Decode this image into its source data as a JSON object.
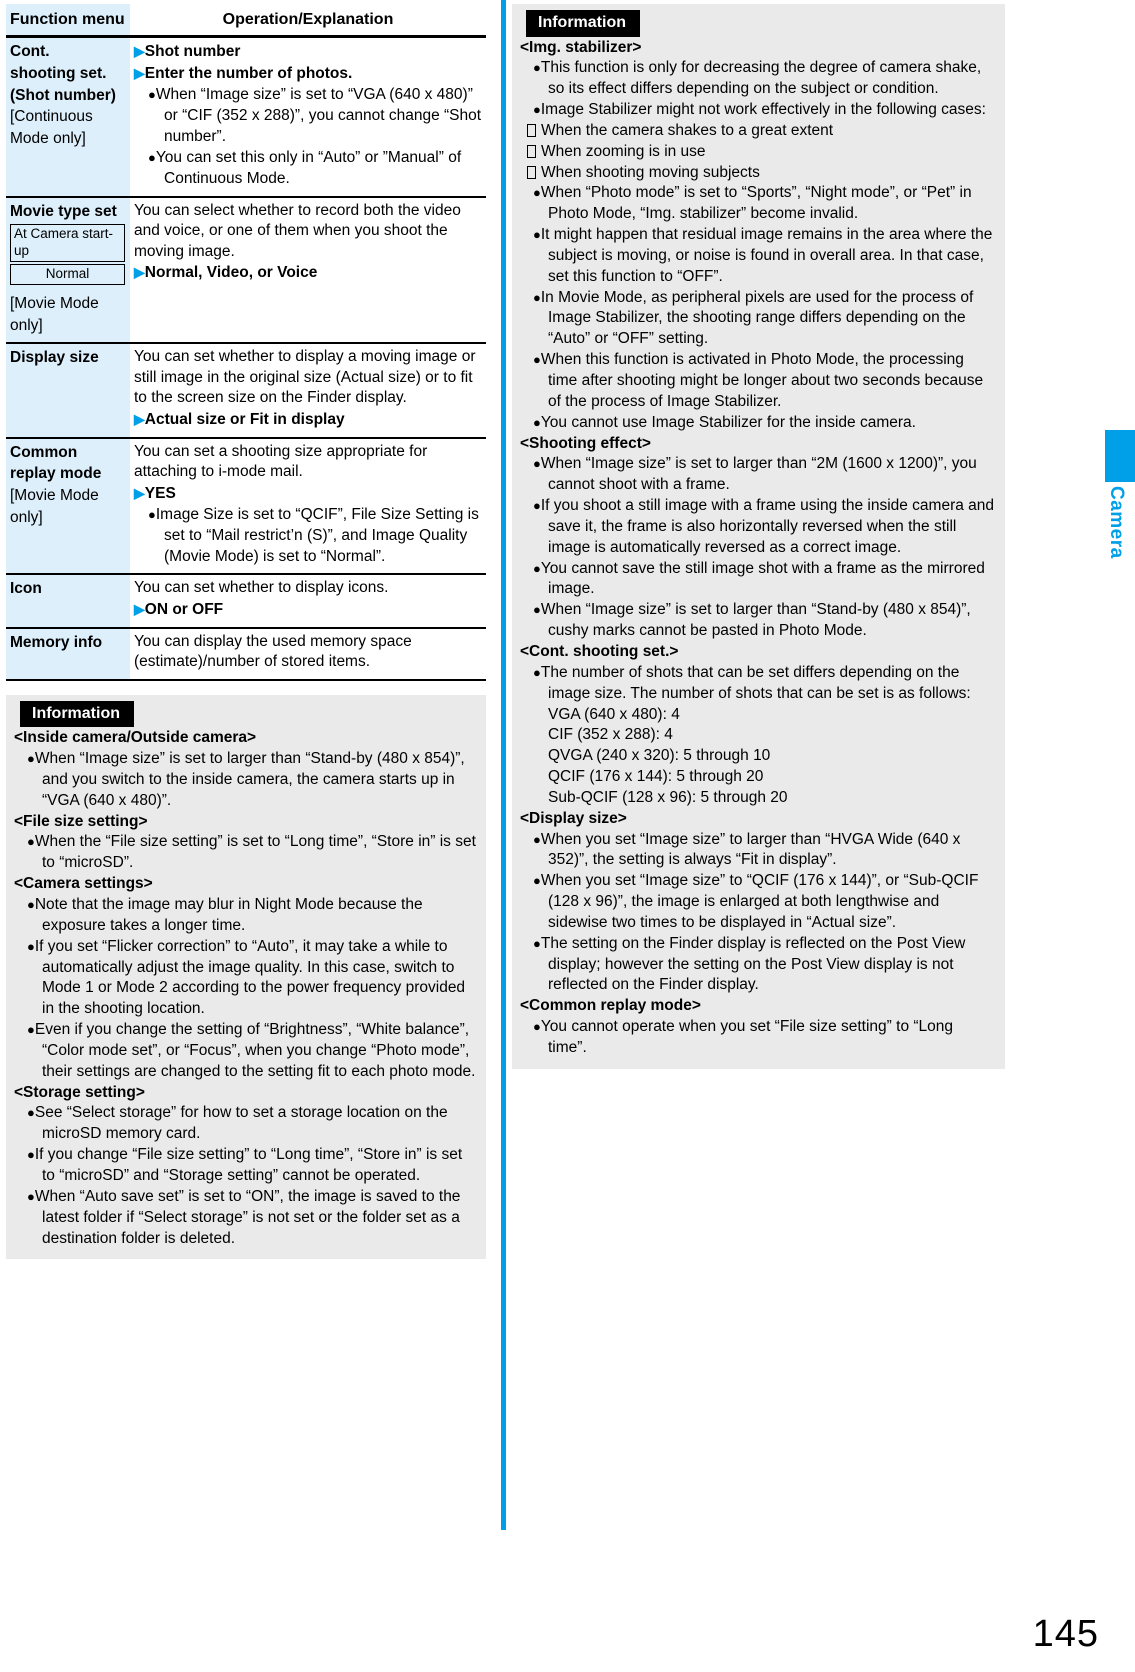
{
  "page_number": "145",
  "side_tab": {
    "label": "Camera"
  },
  "table": {
    "headers": {
      "col1": "Function menu",
      "col2": "Operation/Explanation"
    },
    "rows": [
      {
        "menu_title": "Cont.\nshooting set.\n(Shot number)",
        "menu_note": "[Continuous\nMode only]",
        "operations": [
          "Shot number",
          "Enter the number of photos."
        ],
        "bullets": [
          "When “Image size” is set to “VGA (640 x 480)” or “CIF (352 x 288)”, you cannot change “Shot number”.",
          "You can set this only in “Auto” or ”Manual” of Continuous Mode."
        ]
      },
      {
        "menu_title": "Movie type set",
        "minibox_1": "At Camera start-up",
        "minibox_2": "Normal",
        "menu_note": "[Movie Mode\nonly]",
        "desc": "You can select whether to record both the video and voice, or one of them when you shoot the moving image.",
        "operations": [
          "Normal, Video, or Voice"
        ],
        "bullets": []
      },
      {
        "menu_title": "Display size",
        "menu_note": "",
        "desc": "You can set whether to display a moving image or still image in the original size (Actual size) or to fit to the screen size on the Finder display.",
        "operations": [
          "Actual size or Fit in display"
        ],
        "bullets": []
      },
      {
        "menu_title": "Common\nreplay mode",
        "menu_note": "[Movie Mode\nonly]",
        "desc": "You can set a shooting size appropriate for attaching to i-mode mail.",
        "operations": [
          "YES"
        ],
        "bullets": [
          "Image Size is set to “QCIF”, File Size Setting is set to “Mail restrict’n (S)”, and Image Quality (Movie Mode) is set to “Normal”."
        ]
      },
      {
        "menu_title": "Icon",
        "menu_note": "",
        "desc": "You can set whether to display icons.",
        "operations": [
          "ON or OFF"
        ],
        "bullets": []
      },
      {
        "menu_title": "Memory info",
        "menu_note": "",
        "desc": "You can display the used memory space (estimate)/number of stored items.",
        "operations": [],
        "bullets": []
      }
    ]
  },
  "left_info": {
    "title": "Information",
    "blocks": [
      {
        "heading": "<Inside camera/Outside camera>",
        "items": [
          {
            "type": "bullet",
            "text": "When “Image size” is set to larger than “Stand-by (480 x 854)”, and you switch to the inside camera, the camera starts up in “VGA (640 x 480)”."
          }
        ]
      },
      {
        "heading": "<File size setting>",
        "items": [
          {
            "type": "bullet",
            "text": "When the “File size setting” is set to “Long time”, “Store in” is set to “microSD”."
          }
        ]
      },
      {
        "heading": "<Camera settings>",
        "items": [
          {
            "type": "bullet",
            "text": "Note that the image may blur in Night Mode because the exposure takes a longer time."
          },
          {
            "type": "bullet",
            "text": "If you set “Flicker correction” to “Auto”, it may take a while to automatically adjust the image quality. In this case, switch to Mode 1 or Mode 2 according to the power frequency provided in the shooting location."
          },
          {
            "type": "bullet",
            "text": "Even if you change the setting of “Brightness”, “White balance”, “Color mode set”, or “Focus”, when you change “Photo mode”, their settings are changed to the setting fit to each photo mode."
          }
        ]
      },
      {
        "heading": "<Storage setting>",
        "items": [
          {
            "type": "bullet",
            "text": "See “Select storage” for how to set a storage location on the microSD memory card."
          },
          {
            "type": "bullet",
            "text": "If you change “File size setting” to “Long time”, “Store in” is set to “microSD” and “Storage setting” cannot be operated."
          },
          {
            "type": "bullet",
            "text": "When “Auto save set” is set to “ON”, the image is saved to the latest folder if “Select storage” is not set or the folder set as a destination folder is deleted."
          }
        ]
      }
    ]
  },
  "right_info": {
    "title": "Information",
    "blocks": [
      {
        "heading": "<Img. stabilizer>",
        "items": [
          {
            "type": "bullet",
            "text": "This function is only for decreasing the degree of camera shake, so its effect differs depending on the subject or condition."
          },
          {
            "type": "bullet",
            "text": "Image Stabilizer might not work effectively in the following cases:"
          },
          {
            "type": "subbullet",
            "text": "When the camera shakes to a great extent"
          },
          {
            "type": "subbullet",
            "text": "When zooming is in use"
          },
          {
            "type": "subbullet",
            "text": "When shooting moving subjects"
          },
          {
            "type": "bullet",
            "text": "When “Photo mode” is set to “Sports”, “Night mode”, or “Pet” in Photo Mode, “Img. stabilizer” become invalid."
          },
          {
            "type": "bullet",
            "text": "It might happen that residual image remains in the area where the subject is moving, or noise is found in overall area. In that case, set this function to “OFF”."
          },
          {
            "type": "bullet",
            "text": "In Movie Mode, as peripheral pixels are used for the process of Image Stabilizer, the shooting range differs depending on the “Auto” or “OFF” setting."
          },
          {
            "type": "bullet",
            "text": "When this function is activated in Photo Mode, the processing time after shooting might be longer about two seconds because of the process of Image Stabilizer."
          },
          {
            "type": "bullet",
            "text": "You cannot use Image Stabilizer for the inside camera."
          }
        ]
      },
      {
        "heading": "<Shooting effect>",
        "items": [
          {
            "type": "bullet",
            "text": "When “Image size” is set to larger than “2M (1600 x 1200)”, you cannot shoot with a frame."
          },
          {
            "type": "bullet",
            "text": "If you shoot a still image with a frame using the inside camera and save it, the frame is also horizontally reversed when the still image is automatically reversed as a correct image."
          },
          {
            "type": "bullet",
            "text": "You cannot save the still image shot with a frame as the mirrored image."
          },
          {
            "type": "bullet",
            "text": "When “Image size” is set to larger than “Stand-by (480 x 854)”, cushy marks cannot be pasted in Photo Mode."
          }
        ]
      },
      {
        "heading": "<Cont. shooting set.>",
        "items": [
          {
            "type": "bullet",
            "text": "The number of shots that can be set differs depending on the image size. The number of shots that can be set is as follows:"
          },
          {
            "type": "plain",
            "text": "VGA (640 x 480): 4"
          },
          {
            "type": "plain",
            "text": "CIF (352 x 288): 4"
          },
          {
            "type": "plain",
            "text": "QVGA (240 x 320): 5 through 10"
          },
          {
            "type": "plain",
            "text": "QCIF (176 x 144): 5 through 20"
          },
          {
            "type": "plain",
            "text": "Sub-QCIF (128 x 96): 5 through 20"
          }
        ]
      },
      {
        "heading": "<Display size>",
        "items": [
          {
            "type": "bullet",
            "text": "When you set “Image size” to larger than “HVGA Wide (640 x 352)”, the setting is always “Fit in display”."
          },
          {
            "type": "bullet",
            "text": "When you set “Image size” to “QCIF (176 x 144)”, or “Sub-QCIF (128 x 96)”, the image is enlarged at both lengthwise and sidewise two times to be displayed in “Actual size”."
          },
          {
            "type": "bullet",
            "text": "The setting on the Finder display is reflected on the Post View display; however the setting on the Post View display is not reflected on the Finder display."
          }
        ]
      },
      {
        "heading": "<Common replay mode>",
        "items": [
          {
            "type": "bullet",
            "text": "You cannot operate when you set “File size setting” to “Long time”."
          }
        ]
      }
    ]
  },
  "colors": {
    "accent": "#00a0e9",
    "menu_cell": "#ddeffb",
    "info_bg": "#eaeaea"
  }
}
